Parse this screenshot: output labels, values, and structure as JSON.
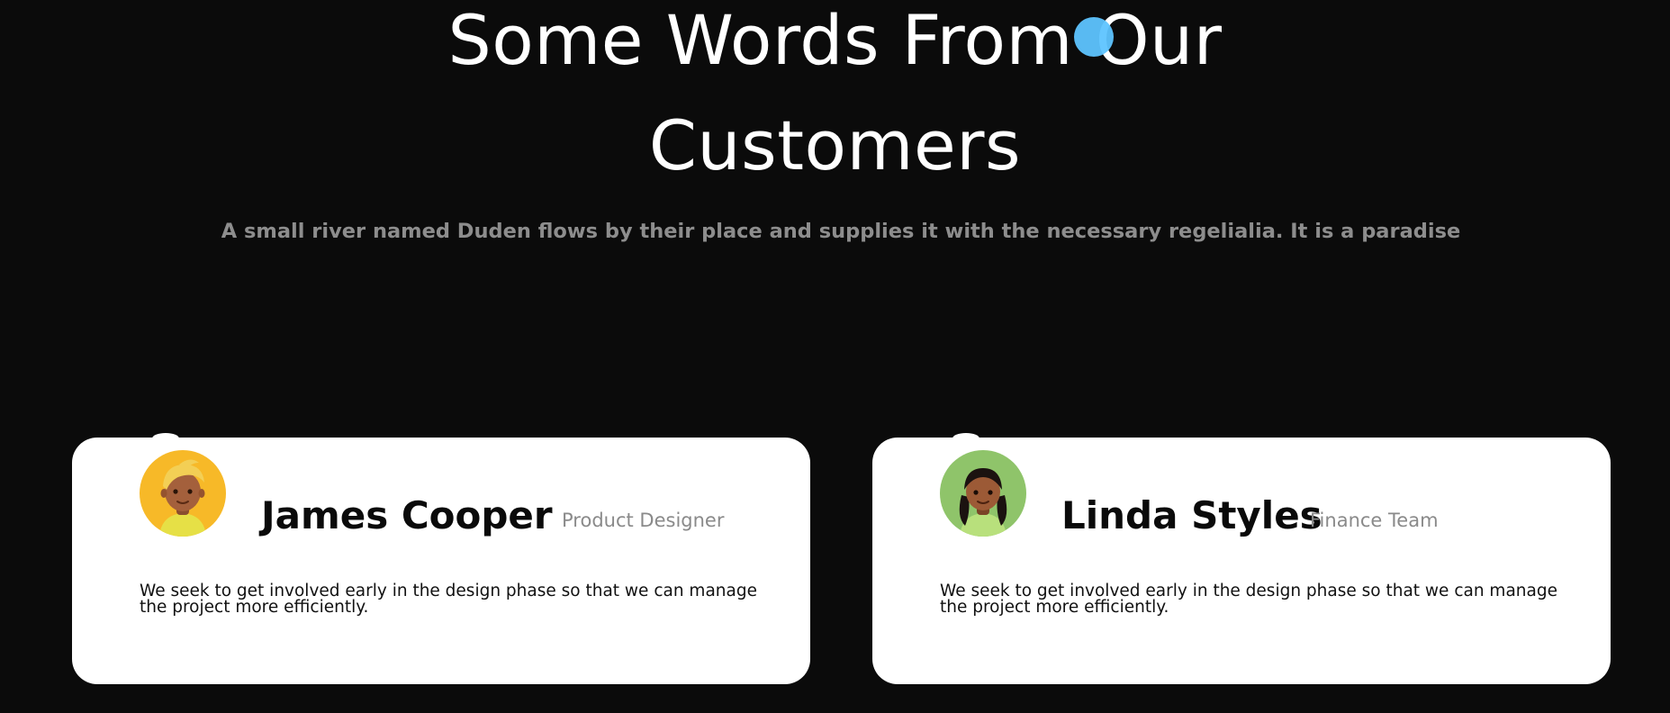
{
  "section": {
    "title_line1": "Some Words From Our",
    "title_line2": "Customers",
    "subtitle": "A small river named Duden flows by their place and supplies it with the necessary regelialia. It is a paradise"
  },
  "testimonials": [
    {
      "name": "James Cooper",
      "role": "Product Designer",
      "quote": "We seek to get involved early in the design phase so that we can manage the project more efficiently.",
      "avatar_bg": "#f7b928"
    },
    {
      "name": "Linda Styles",
      "role": "Finance Team",
      "quote": "We seek to get involved early in the design phase so that we can manage the project more efficiently.",
      "avatar_bg": "#8fc46a"
    }
  ],
  "colors": {
    "background": "#0b0b0b",
    "card": "#ffffff",
    "subtitle": "#8d8d8d",
    "cursor": "#5ec4ff"
  }
}
